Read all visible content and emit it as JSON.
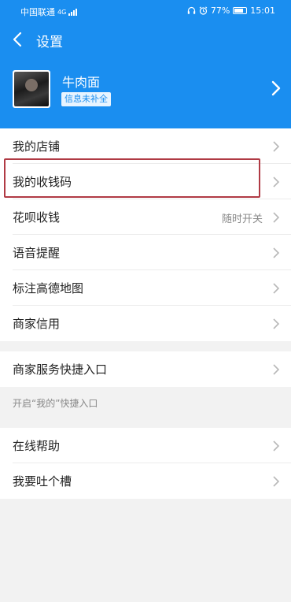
{
  "status_bar": {
    "carrier": "中国联通",
    "network": "4G",
    "battery": "77%",
    "time": "15:01",
    "icons": [
      "signal-icon",
      "headset-icon",
      "alarm-icon",
      "battery-icon"
    ]
  },
  "nav": {
    "back_icon": "chevron-left-icon",
    "title": "设置"
  },
  "profile": {
    "name": "牛肉面",
    "badge": "信息未补全",
    "chevron_icon": "chevron-right-icon"
  },
  "group1": {
    "items": [
      {
        "label": "我的店铺",
        "value": ""
      },
      {
        "label": "我的收钱码",
        "value": ""
      },
      {
        "label": "花呗收钱",
        "value": "随时开关"
      },
      {
        "label": "语音提醒",
        "value": ""
      },
      {
        "label": "标注高德地图",
        "value": ""
      },
      {
        "label": "商家信用",
        "value": ""
      }
    ]
  },
  "group2": {
    "items": [
      {
        "label": "商家服务快捷入口"
      }
    ],
    "hint": "开启“我的”快捷入口"
  },
  "group3": {
    "items": [
      {
        "label": "在线帮助"
      },
      {
        "label": "我要吐个槽"
      }
    ]
  },
  "colors": {
    "header_bg": "#1a8ef0",
    "page_bg": "#f2f2f2",
    "highlight_border": "#b03a44"
  }
}
